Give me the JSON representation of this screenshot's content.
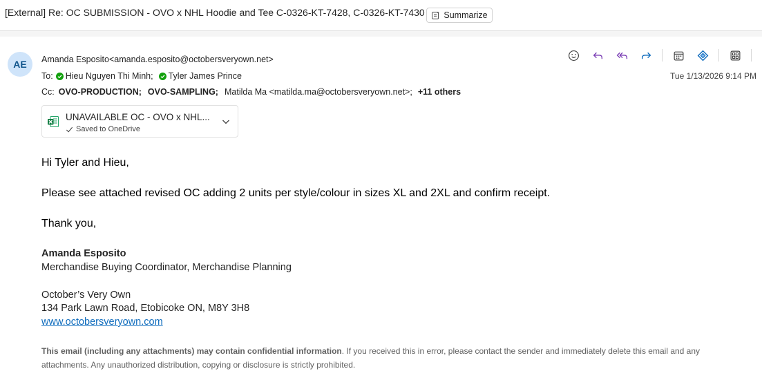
{
  "subject": {
    "text": "[External] Re: OC SUBMISSION - OVO x NHL Hoodie and Tee C-0326-KT-7428, C-0326-KT-7430",
    "summarize_label": "Summarize"
  },
  "sender": {
    "initials": "AE",
    "avatar_color": "#cfe4fa",
    "name": "Amanda Esposito",
    "email": "<amanda.esposito@octobersveryown.net>"
  },
  "recipients": {
    "to_label": "To:",
    "to": [
      "Hieu Nguyen Thi Minh;",
      "Tyler James Prince"
    ],
    "cc_label": "Cc:",
    "cc": [
      "OVO-PRODUCTION;",
      "OVO-SAMPLING;",
      "Matilda Ma <matilda.ma@octobersveryown.net>;"
    ],
    "others": "+11 others"
  },
  "date": "Tue 1/13/2026 9:14 PM",
  "toolbar": {
    "icons": [
      "emoji-icon",
      "reply-icon",
      "reply-all-icon",
      "forward-icon",
      "calendar-icon",
      "loop-icon",
      "apps-icon",
      "more-icon"
    ]
  },
  "attachment": {
    "name": "UNAVAILABLE OC - OVO x NHL...",
    "status": "Saved to OneDrive",
    "icon": "excel-icon"
  },
  "body": {
    "greeting": "Hi Tyler and Hieu,",
    "message": "Please see attached revised OC adding 2 units per style/colour in sizes XL and 2XL and confirm receipt.",
    "closing": "Thank you,"
  },
  "signature": {
    "name": "Amanda Esposito",
    "title": "Merchandise Buying Coordinator, Merchandise Planning",
    "company": "October’s Very Own",
    "address": "134 Park Lawn Road, Etobicoke ON, M8Y 3H8",
    "website": "www.octobersveryown.com"
  },
  "disclaimer": {
    "bold": "This email (including any attachments) may contain confidential information",
    "rest": ". If you received this in error, please contact the sender and immediately delete this email and any attachments. Any unauthorized distribution, copying or disclosure is strictly prohibited."
  },
  "colors": {
    "accent": "#0f6cbd",
    "check_green": "#13a10e"
  }
}
